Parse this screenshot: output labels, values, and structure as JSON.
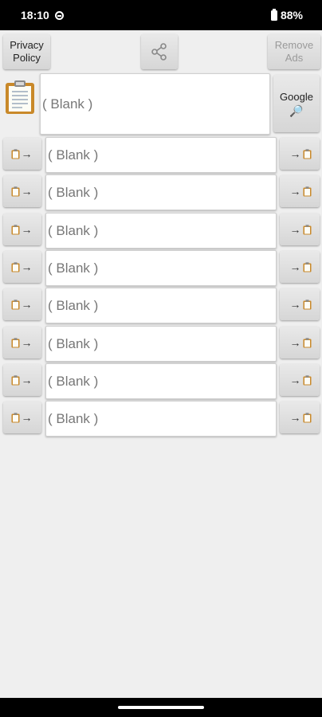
{
  "status": {
    "time": "18:10",
    "battery": "88%"
  },
  "top": {
    "privacy_label": "Privacy Policy",
    "remove_ads_label": "Remove Ads",
    "share_icon": "share-icon"
  },
  "main": {
    "value": "( Blank )",
    "google_label": "Google",
    "google_icon": "magnifier-icon"
  },
  "rows": [
    {
      "value": "( Blank )"
    },
    {
      "value": "( Blank )"
    },
    {
      "value": "( Blank )"
    },
    {
      "value": "( Blank )"
    },
    {
      "value": "( Blank )"
    },
    {
      "value": "( Blank )"
    },
    {
      "value": "( Blank )"
    },
    {
      "value": "( Blank )"
    }
  ],
  "icons": {
    "left_button": "clipboard-to-arrow-icon",
    "right_button": "arrow-to-clipboard-icon"
  },
  "colors": {
    "clipboard_brown": "#c9892a",
    "paper": "#fdfdf6",
    "accent_blue": "#2b7ad8"
  }
}
